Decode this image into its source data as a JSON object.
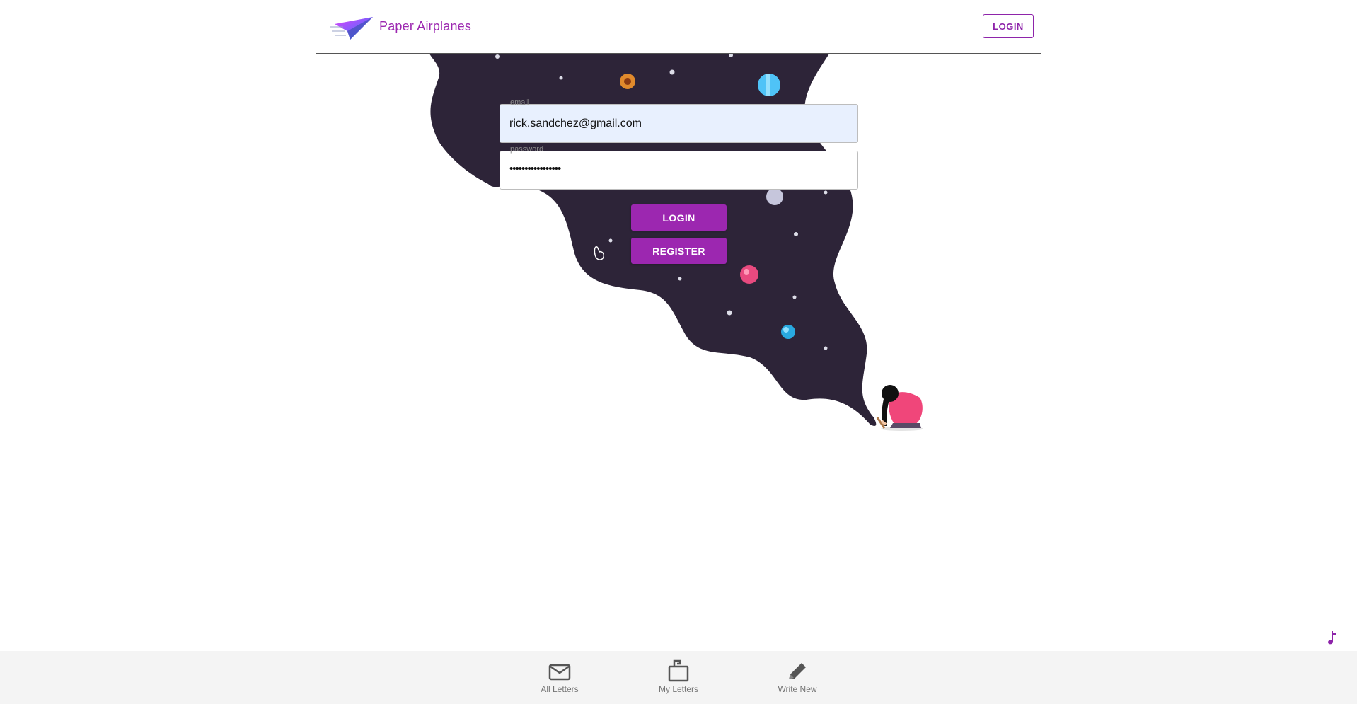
{
  "header": {
    "brand": "Paper Airplanes",
    "login_label": "LOGIN",
    "logo_icon": "paper-airplane-logo"
  },
  "form": {
    "email": {
      "label": "email",
      "value": "rick.sandchez@gmail.com"
    },
    "password": {
      "label": "password",
      "value": "•••••••••••••••••"
    },
    "login_label": "LOGIN",
    "register_label": "REGISTER"
  },
  "bottom_nav": {
    "items": [
      {
        "label": "All Letters",
        "icon": "envelope-icon"
      },
      {
        "label": "My Letters",
        "icon": "mailbox-icon"
      },
      {
        "label": "Write New",
        "icon": "pencil-icon"
      }
    ]
  },
  "colors": {
    "accent": "#9c27b0",
    "space": "#2d2438",
    "nav_bg": "#f4f4f4"
  }
}
